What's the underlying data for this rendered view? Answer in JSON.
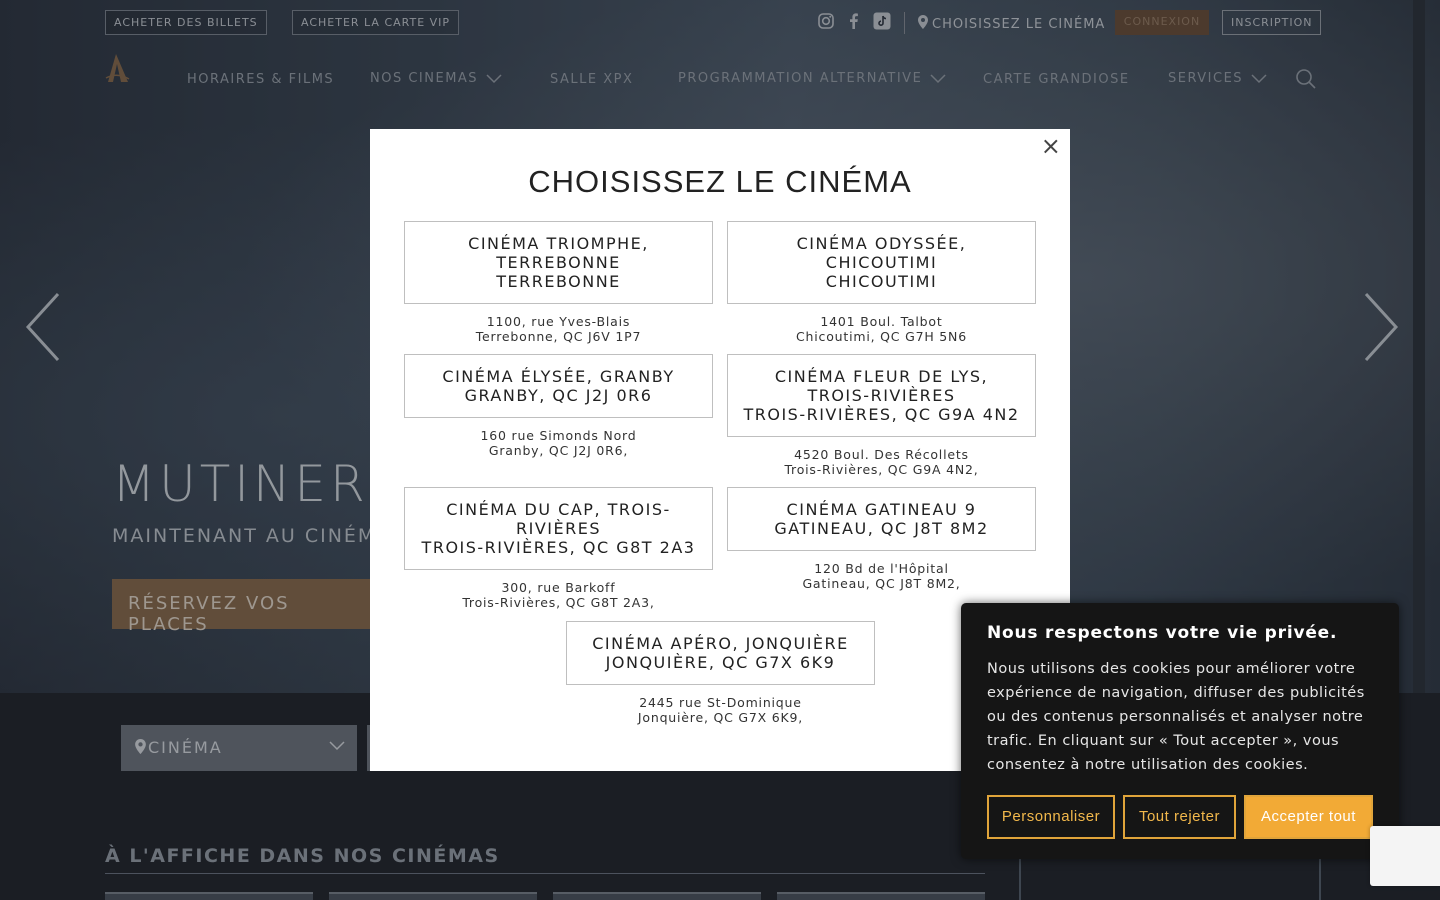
{
  "topbar": {
    "buy_tickets": "ACHETER DES BILLETS",
    "buy_vip": "ACHETER LA CARTE VIP",
    "choose_cinema": "CHOISISSEZ LE CINÉMA",
    "login": "CONNEXION",
    "signup": "INSCRIPTION"
  },
  "nav": {
    "items": [
      {
        "label": "HORAIRES & FILMS"
      },
      {
        "label": "NOS CINEMAS"
      },
      {
        "label": "SALLE XPX"
      },
      {
        "label": "PROGRAMMATION ALTERNATIVE"
      },
      {
        "label": "CARTE GRANDIOSE"
      },
      {
        "label": "SERVICES"
      }
    ]
  },
  "hero": {
    "title": "MUTINERI",
    "subtitle": "MAINTENANT AU CINÉM",
    "cta": "RÉSERVEZ VOS PLACES"
  },
  "filter": {
    "cinema_label": "CINÉMA"
  },
  "section": {
    "title": "À L'AFFICHE DANS NOS CINÉMAS"
  },
  "modal": {
    "title": "CHOISISSEZ LE CINÉMA",
    "close": "×",
    "cinemas": [
      {
        "lines": [
          "CINÉMA TRIOMPHE,",
          "TERREBONNE",
          "TERREBONNE"
        ],
        "addr1": "1100, rue Yves-Blais",
        "addr2": "Terrebonne, QC J6V 1P7"
      },
      {
        "lines": [
          "CINÉMA ODYSSÉE,",
          "CHICOUTIMI",
          "CHICOUTIMI"
        ],
        "addr1": "1401 Boul. Talbot",
        "addr2": "Chicoutimi, QC G7H 5N6"
      },
      {
        "lines": [
          "CINÉMA ÉLYSÉE, GRANBY",
          "GRANBY, QC J2J 0R6"
        ],
        "addr1": "160 rue Simonds Nord",
        "addr2": "Granby, QC J2J 0R6,"
      },
      {
        "lines": [
          "CINÉMA FLEUR DE LYS,",
          "TROIS-RIVIÈRES",
          "TROIS-RIVIÈRES, QC G9A 4N2"
        ],
        "addr1": "4520 Boul. Des Récollets",
        "addr2": "Trois-Rivières, QC G9A 4N2,"
      },
      {
        "lines": [
          "CINÉMA DU CAP, TROIS-",
          "RIVIÈRES",
          "TROIS-RIVIÈRES, QC G8T 2A3"
        ],
        "addr1": "300, rue Barkoff",
        "addr2": "Trois-Rivières, QC G8T 2A3,"
      },
      {
        "lines": [
          "CINÉMA GATINEAU 9",
          "GATINEAU, QC J8T 8M2"
        ],
        "addr1": "120 Bd de l'Hôpital",
        "addr2": "Gatineau, QC J8T 8M2,"
      },
      {
        "lines": [
          "CINÉMA APÉRO, JONQUIÈRE",
          "JONQUIÈRE, QC G7X 6K9"
        ],
        "addr1": "2445 rue St-Dominique",
        "addr2": "Jonquière, QC G7X 6K9,"
      }
    ]
  },
  "cookie": {
    "title": "Nous respectons votre vie privée.",
    "text": "Nous utilisons des cookies pour améliorer votre expérience de navigation, diffuser des publicités ou des contenus personnalisés et analyser notre trafic. En cliquant sur « Tout accepter », vous consentez à notre utilisation des cookies.",
    "customize": "Personnaliser",
    "reject": "Tout rejeter",
    "accept": "Accepter tout"
  },
  "colors": {
    "accent": "#f2aa36",
    "brand_brown": "#8a6b4b",
    "bg": "#1f2229"
  }
}
